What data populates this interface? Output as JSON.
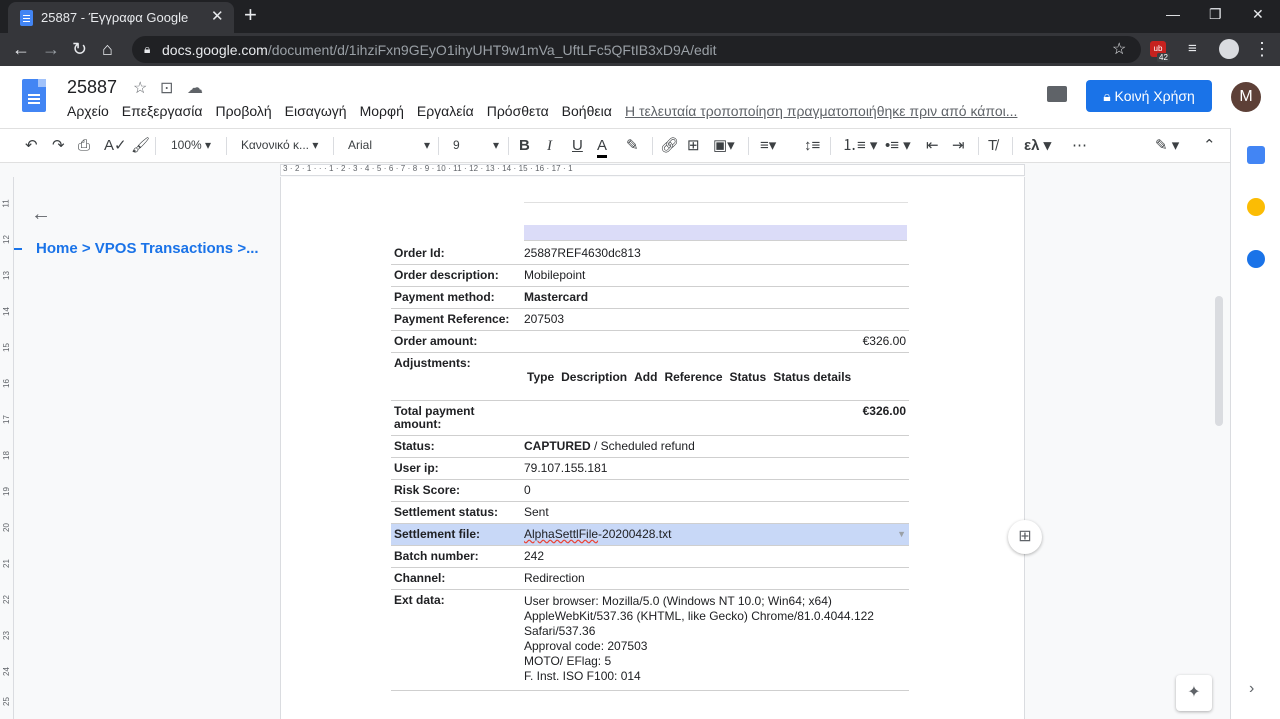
{
  "browser": {
    "tab_title": "25887 - Έγγραφα Google",
    "tab_close": "✕",
    "new_tab": "+",
    "url_host": "docs.google.com",
    "url_path": "/document/d/1ihziFxn9GEyO1ihyUHT9w1mVa_UftLFc5QFtIB3xD9A/edit",
    "extension_count": "42"
  },
  "docs": {
    "title": "25887",
    "menu": [
      "Αρχείο",
      "Επεξεργασία",
      "Προβολή",
      "Εισαγωγή",
      "Μορφή",
      "Εργαλεία",
      "Πρόσθετα",
      "Βοήθεια"
    ],
    "last_edit": "Η τελευταία τροποποίηση πραγματοποιήθηκε πριν από κάποι...",
    "share_label": "Κοινή Χρήση",
    "avatar_letter": "M"
  },
  "toolbar": {
    "zoom": "100%",
    "style": "Κανονικό κ...",
    "font": "Arial",
    "size": "9"
  },
  "ruler": {
    "text": "3 · 2 · 1 · · · 1 · 2 · 3 · 4 · 5 · 6 · 7 · 8 · 9 · 10 · 11 · 12 · 13 · 14 · 15 · 16 · 17 · 1",
    "vertical": [
      "11",
      "12",
      "13",
      "14",
      "15",
      "16",
      "17",
      "18",
      "19",
      "20",
      "21",
      "22",
      "23",
      "24",
      "25"
    ]
  },
  "outline": {
    "item": "Home > VPOS Transactions >..."
  },
  "order": {
    "order_id_label": "Order Id:",
    "order_id": "25887REF4630dc813",
    "description_label": "Order description:",
    "description": "Mobilepoint",
    "payment_method_label": "Payment method:",
    "payment_method": "Mastercard",
    "payment_ref_label": "Payment Reference:",
    "payment_ref": "207503",
    "order_amount_label": "Order amount:",
    "order_amount": "€326.00",
    "adjustments_label": "Adjustments:",
    "adjustment_columns": [
      "Type",
      "Description",
      "Add",
      "Reference",
      "Status",
      "Status details"
    ],
    "total_label": "Total payment amount:",
    "total": "€326.00",
    "status_label": "Status:",
    "status_main": "CAPTURED",
    "status_rest": " / Scheduled refund",
    "user_ip_label": "User ip:",
    "user_ip": "79.107.155.181",
    "risk_label": "Risk Score:",
    "risk": "0",
    "settlement_status_label": "Settlement status:",
    "settlement_status": "Sent",
    "settlement_file_label": "Settlement file:",
    "settlement_file_name": "AlphaSettlFile",
    "settlement_file_rest": "-20200428.txt",
    "batch_label": "Batch number:",
    "batch": "242",
    "channel_label": "Channel:",
    "channel": "Redirection",
    "ext_label": "Ext data:",
    "ext_lines": [
      "User browser: Mozilla/5.0 (Windows NT 10.0; Win64; x64)",
      "AppleWebKit/537.36 (KHTML, like Gecko) Chrome/81.0.4044.122",
      "Safari/537.36",
      "Approval code: 207503",
      "MOTO/ EFlag: 5",
      "F. Inst. ISO F100: 014"
    ]
  },
  "colors": {
    "accent": "#1a73e8",
    "selection": "#c8d8f7"
  }
}
